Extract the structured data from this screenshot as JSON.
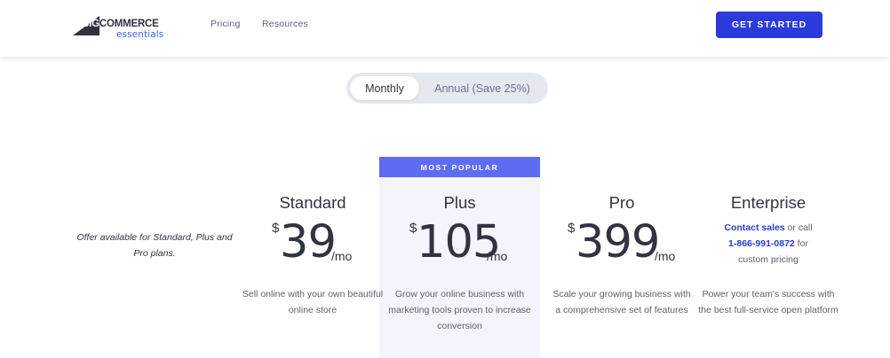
{
  "header": {
    "logo_big": "BIG",
    "logo_commerce": "COMMERCE",
    "logo_sub": "essentials",
    "nav": [
      "Pricing",
      "Resources"
    ],
    "cta_label": "GET STARTED"
  },
  "billing_toggle": {
    "options": [
      "Monthly",
      "Annual (Save 25%)"
    ],
    "selected": "Monthly"
  },
  "offer_note": "Offer available for Standard, Plus and Pro plans.",
  "badge": "MOST POPULAR",
  "plans": [
    {
      "name": "Standard",
      "currency": "$",
      "price": "39",
      "period": "/mo",
      "description": "Sell online with your own beautiful online store"
    },
    {
      "name": "Plus",
      "currency": "$",
      "price": "105",
      "period": "/mo",
      "description": "Grow your online business with marketing tools proven to increase conversion"
    },
    {
      "name": "Pro",
      "currency": "$",
      "price": "399",
      "period": "/mo",
      "description": "Scale your growing business with a comprehensive set of features"
    },
    {
      "name": "Enterprise",
      "contact_link": "Contact sales",
      "contact_text_1": " or call",
      "phone_link": "1-866-991-0872",
      "contact_text_2": " for",
      "contact_text_3": "custom pricing",
      "description": "Power your team's success with the best full-service open platform"
    }
  ],
  "colors": {
    "accent": "#2b3bdb",
    "badge": "#5e6cf3",
    "highlight_bg": "#f3f4fc"
  }
}
